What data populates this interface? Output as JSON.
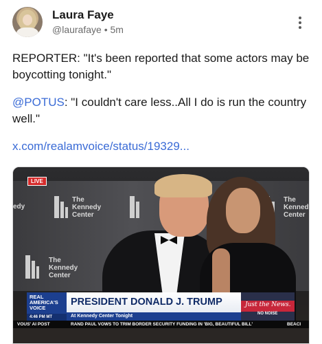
{
  "author": {
    "name": "Laura Faye",
    "handle": "@laurafaye",
    "separator": "•",
    "time": "5m",
    "avatar_icon": "avatar-photo"
  },
  "post": {
    "line1": "REPORTER: \"It's been reported that some actors may be boycotting tonight.\"",
    "mention": "@POTUS",
    "line2_rest": ": \"I couldn't care less..All I do is run the country well.\"",
    "link": "x.com/realamvoice/status/19329..."
  },
  "media": {
    "live_badge": "LIVE",
    "logo_text_1": "The Kennedy Center",
    "logo_text_2": "The Kennedy Center",
    "logo_text_3": "The Kennedy Center",
    "logo_text_4": "The Kennedy Center",
    "edge_text": "edy",
    "network": "REAL AMERICA'S VOICE",
    "network_time": "4:46 PM MT",
    "headline": "PRESIDENT DONALD J. TRUMP",
    "subhead": "At Kennedy Center Tonight",
    "brand_top": "Just the News.",
    "brand_bottom": "NO NOISE",
    "ticker_left": "VOUS' AI POST",
    "ticker_main": "RAND PAUL VOWS TO TRIM BORDER SECURITY FUNDING IN 'BIG, BEAUTIFUL BILL'",
    "ticker_right": "BEACI"
  },
  "colors": {
    "link": "#3a6bd6",
    "network_blue": "#1c3f8f",
    "live_red": "#d62b2b"
  }
}
